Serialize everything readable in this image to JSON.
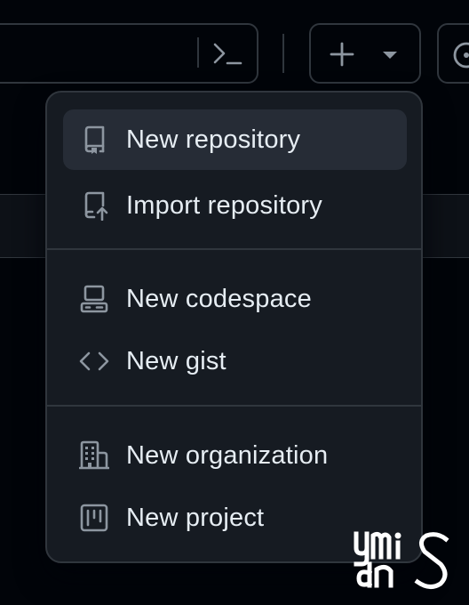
{
  "header": {
    "command_icon": "command-palette-icon",
    "create_icon": "plus-icon",
    "create_caret_icon": "triangle-down-icon",
    "issues_icon": "issue-opened-icon"
  },
  "menu": {
    "items": [
      {
        "label": "New repository",
        "icon": "repo-icon",
        "active": true
      },
      {
        "label": "Import repository",
        "icon": "repo-push-icon",
        "active": false
      },
      {
        "label": "New codespace",
        "icon": "codespaces-icon",
        "active": false
      },
      {
        "label": "New gist",
        "icon": "code-icon",
        "active": false
      },
      {
        "label": "New organization",
        "icon": "organization-icon",
        "active": false
      },
      {
        "label": "New project",
        "icon": "project-icon",
        "active": false
      }
    ]
  },
  "watermark": {
    "text": "ymis dnS"
  },
  "colors": {
    "background": "#010409",
    "menu_bg": "#161b22",
    "menu_active_bg": "#262c36",
    "border": "#30363d",
    "text": "#e6edf3",
    "icon": "#8d96a0"
  }
}
